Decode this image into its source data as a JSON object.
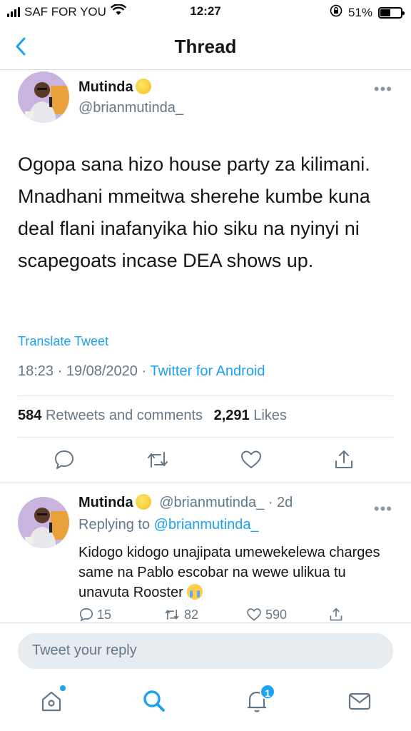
{
  "status_bar": {
    "carrier": "SAF FOR YOU",
    "time": "12:27",
    "battery_percent": "51%",
    "battery_level": 0.51
  },
  "header": {
    "title": "Thread"
  },
  "main_tweet": {
    "name": "Mutinda",
    "handle": "@brianmutinda_",
    "text": "Ogopa sana hizo house party za kilimani. Mnadhani mmeitwa sherehe kumbe kuna deal flani inafanyika hio siku na nyinyi ni scapegoats incase DEA shows up.",
    "translate_label": "Translate Tweet",
    "timestamp": "18:23 · 19/08/2020 · ",
    "client": "Twitter for Android",
    "retweets_count": "584",
    "retweets_label": "Retweets and comments",
    "likes_count": "2,291",
    "likes_label": "Likes"
  },
  "reply": {
    "name": "Mutinda",
    "handle_time": "@brianmutinda_ · 2d",
    "replying_to_prefix": "Replying to ",
    "replying_to_handle": "@brianmutinda_",
    "text": "Kidogo kidogo unajipata umewekelewa charges same na Pablo escobar na wewe ulikua tu unavuta Rooster",
    "comments": "15",
    "retweets": "82",
    "likes": "590"
  },
  "compose": {
    "placeholder": "Tweet your reply"
  },
  "tabbar": {
    "notification_count": "1"
  },
  "colors": {
    "accent": "#1da1f2",
    "secondary_text": "#657786",
    "primary_text": "#14171a"
  }
}
